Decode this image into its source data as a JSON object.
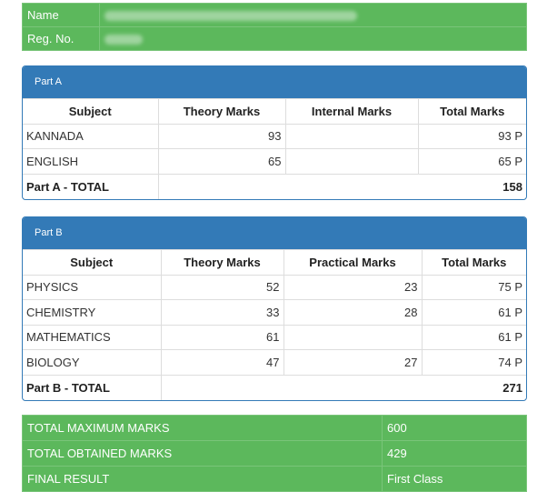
{
  "student": {
    "name_label": "Name",
    "reg_label": "Reg. No."
  },
  "part_a": {
    "title": "Part A",
    "headers": [
      "Subject",
      "Theory Marks",
      "Internal Marks",
      "Total Marks"
    ],
    "rows": [
      {
        "subject": "KANNADA",
        "theory": "93",
        "internal": "",
        "total": "93 P"
      },
      {
        "subject": "ENGLISH",
        "theory": "65",
        "internal": "",
        "total": "65 P"
      }
    ],
    "total_label": "Part A - TOTAL",
    "total_value": "158"
  },
  "part_b": {
    "title": "Part B",
    "headers": [
      "Subject",
      "Theory Marks",
      "Practical Marks",
      "Total Marks"
    ],
    "rows": [
      {
        "subject": "PHYSICS",
        "theory": "52",
        "practical": "23",
        "total": "75 P"
      },
      {
        "subject": "CHEMISTRY",
        "theory": "33",
        "practical": "28",
        "total": "61 P"
      },
      {
        "subject": "MATHEMATICS",
        "theory": "61",
        "practical": "",
        "total": "61 P"
      },
      {
        "subject": "BIOLOGY",
        "theory": "47",
        "practical": "27",
        "total": "74 P"
      }
    ],
    "total_label": "Part B - TOTAL",
    "total_value": "271"
  },
  "summary": {
    "max_label": "TOTAL MAXIMUM MARKS",
    "max_value": "600",
    "obtained_label": "TOTAL OBTAINED MARKS",
    "obtained_value": "429",
    "result_label": "FINAL RESULT",
    "result_value": "First Class"
  },
  "colors": {
    "green": "#5cb85c",
    "blue": "#337ab7"
  }
}
